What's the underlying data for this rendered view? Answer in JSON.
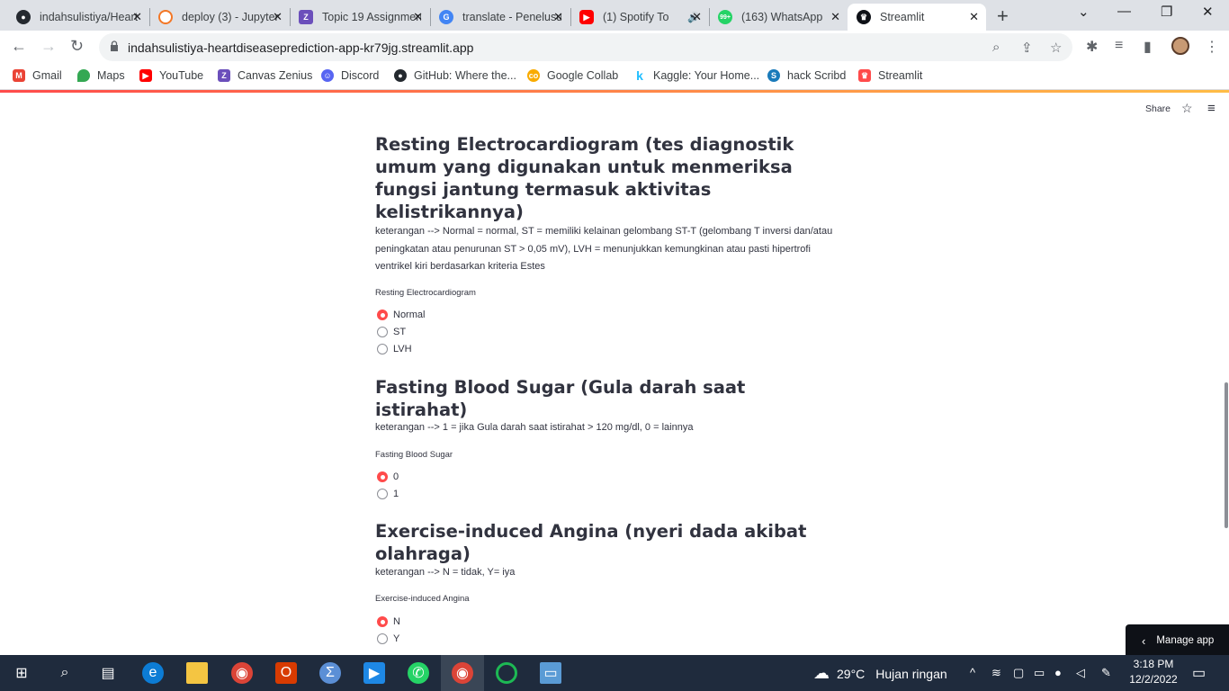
{
  "browser": {
    "tabs": [
      {
        "title": "indahsulistiya/Heart",
        "icon": "github-icon",
        "color": "#24292f"
      },
      {
        "title": "deploy (3) - Jupyter",
        "icon": "jupyter-icon",
        "color": "#f37726"
      },
      {
        "title": "Topic 19 Assignment",
        "icon": "zenius-icon",
        "color": "#6b4fbb"
      },
      {
        "title": "translate - Penelusuran",
        "icon": "google-icon",
        "color": "#4285f4"
      },
      {
        "title": "(1) Spotify To",
        "icon": "youtube-icon",
        "color": "#ff0000"
      },
      {
        "title": "(163) WhatsApp",
        "icon": "whatsapp-icon",
        "color": "#25d366",
        "badge": "99+"
      },
      {
        "title": "Streamlit",
        "icon": "streamlit-icon",
        "color": "#0e1117"
      }
    ],
    "active_tab_index": 6,
    "url": "indahsulistiya-heartdiseaseprediction-app-kr79jg.streamlit.app",
    "bookmarks": [
      {
        "label": "Gmail",
        "icon": "gmail-icon",
        "color": "#ea4335"
      },
      {
        "label": "Maps",
        "icon": "maps-pin-icon",
        "color": "#34a853"
      },
      {
        "label": "YouTube",
        "icon": "youtube-icon",
        "color": "#ff0000"
      },
      {
        "label": "Canvas Zenius",
        "icon": "zenius-icon",
        "color": "#6b4fbb"
      },
      {
        "label": "Discord",
        "icon": "discord-icon",
        "color": "#5865f2"
      },
      {
        "label": "GitHub: Where the...",
        "icon": "github-icon",
        "color": "#24292f"
      },
      {
        "label": "Google Collab",
        "icon": "colab-icon",
        "color": "#f9ab00"
      },
      {
        "label": "Kaggle: Your Home...",
        "icon": "kaggle-icon",
        "color": "#20beff"
      },
      {
        "label": "hack Scribd",
        "icon": "scribd-icon",
        "color": "#1a7bba"
      },
      {
        "label": "Streamlit",
        "icon": "streamlit-icon",
        "color": "#ff4b4b"
      }
    ]
  },
  "app": {
    "share_label": "Share",
    "manage_label": "Manage app",
    "sections": [
      {
        "heading": "Resting Electrocardiogram (tes diagnostik umum yang digunakan untuk menmeriksa fungsi jantung termasuk aktivitas kelistrikannya)",
        "description": "keterangan --> Normal = normal, ST = memiliki kelainan gelombang ST-T (gelombang T inversi dan/atau peningkatan atau penurunan ST > 0,05 mV), LVH = menunjukkan kemungkinan atau pasti hipertrofi ventrikel kiri berdasarkan kriteria Estes",
        "label": "Resting Electrocardiogram",
        "options": [
          "Normal",
          "ST",
          "LVH"
        ],
        "selected": "Normal"
      },
      {
        "heading": "Fasting Blood Sugar (Gula darah saat istirahat)",
        "description": "keterangan --> 1 = jika Gula darah saat istirahat > 120 mg/dl, 0 = lainnya",
        "label": "Fasting Blood Sugar",
        "options": [
          "0",
          "1"
        ],
        "selected": "0"
      },
      {
        "heading": "Exercise-induced Angina (nyeri dada akibat olahraga)",
        "description": "keterangan --> N = tidak, Y= iya",
        "label": "Exercise-induced Angina",
        "options": [
          "N",
          "Y"
        ],
        "selected": "N"
      }
    ]
  },
  "taskbar": {
    "weather_temp": "29°C",
    "weather_text": "Hujan ringan",
    "time": "3:18 PM",
    "date": "12/2/2022"
  }
}
